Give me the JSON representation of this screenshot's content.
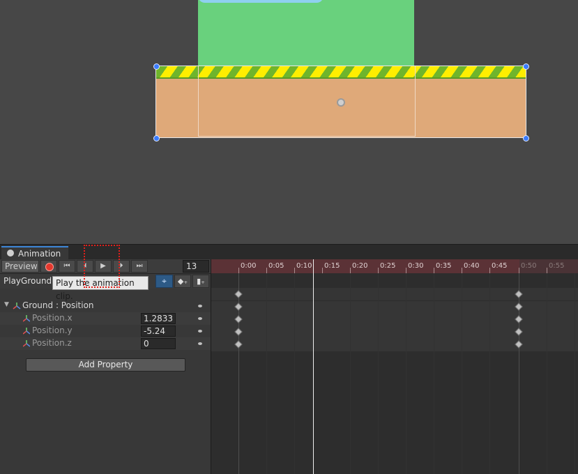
{
  "window": {
    "tab_label": "Animation"
  },
  "toolbar": {
    "preview_label": "Preview",
    "first_key_glyph": "⏮",
    "prev_key_glyph": "⏴",
    "play_glyph": "▶",
    "next_key_glyph": "⏵",
    "last_key_glyph": "⏭",
    "frame": "13"
  },
  "clip": {
    "name": "PlayGround"
  },
  "tooltip": {
    "text": "Play the animation clip."
  },
  "tools": {
    "snap_glyph": "⌖",
    "add_key_glyph": "◆₊",
    "add_event_glyph": "▮₊"
  },
  "properties": {
    "group_label": "Ground : Position",
    "items": [
      {
        "label": "Position.x",
        "value": "1.2833"
      },
      {
        "label": "Position.y",
        "value": "-5.24"
      },
      {
        "label": "Position.z",
        "value": "0"
      }
    ],
    "add_property_label": "Add Property"
  },
  "timeline": {
    "ticks": [
      "0:00",
      "0:05",
      "0:10",
      "0:15",
      "0:20",
      "0:25",
      "0:30",
      "0:35",
      "0:40",
      "0:45",
      "0:50",
      "0:55"
    ]
  },
  "colors": {
    "record": "#e3382d",
    "playhead": "#f0f0f0",
    "highlight": "#e3201b",
    "ruler": "#5b3236"
  }
}
